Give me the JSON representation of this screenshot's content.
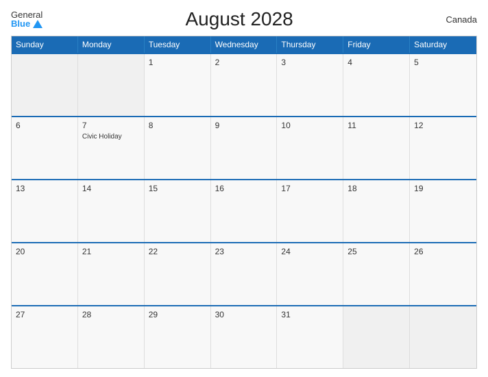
{
  "header": {
    "title": "August 2028",
    "country": "Canada",
    "logo_general": "General",
    "logo_blue": "Blue"
  },
  "days_of_week": [
    "Sunday",
    "Monday",
    "Tuesday",
    "Wednesday",
    "Thursday",
    "Friday",
    "Saturday"
  ],
  "weeks": [
    [
      {
        "day": "",
        "empty": true
      },
      {
        "day": "",
        "empty": true
      },
      {
        "day": "1",
        "empty": false
      },
      {
        "day": "2",
        "empty": false
      },
      {
        "day": "3",
        "empty": false
      },
      {
        "day": "4",
        "empty": false
      },
      {
        "day": "5",
        "empty": false
      }
    ],
    [
      {
        "day": "6",
        "empty": false
      },
      {
        "day": "7",
        "empty": false,
        "event": "Civic Holiday"
      },
      {
        "day": "8",
        "empty": false
      },
      {
        "day": "9",
        "empty": false
      },
      {
        "day": "10",
        "empty": false
      },
      {
        "day": "11",
        "empty": false
      },
      {
        "day": "12",
        "empty": false
      }
    ],
    [
      {
        "day": "13",
        "empty": false
      },
      {
        "day": "14",
        "empty": false
      },
      {
        "day": "15",
        "empty": false
      },
      {
        "day": "16",
        "empty": false
      },
      {
        "day": "17",
        "empty": false
      },
      {
        "day": "18",
        "empty": false
      },
      {
        "day": "19",
        "empty": false
      }
    ],
    [
      {
        "day": "20",
        "empty": false
      },
      {
        "day": "21",
        "empty": false
      },
      {
        "day": "22",
        "empty": false
      },
      {
        "day": "23",
        "empty": false
      },
      {
        "day": "24",
        "empty": false
      },
      {
        "day": "25",
        "empty": false
      },
      {
        "day": "26",
        "empty": false
      }
    ],
    [
      {
        "day": "27",
        "empty": false
      },
      {
        "day": "28",
        "empty": false
      },
      {
        "day": "29",
        "empty": false
      },
      {
        "day": "30",
        "empty": false
      },
      {
        "day": "31",
        "empty": false
      },
      {
        "day": "",
        "empty": true
      },
      {
        "day": "",
        "empty": true
      }
    ]
  ],
  "colors": {
    "header_bg": "#1a6bb5",
    "accent": "#2196F3"
  }
}
